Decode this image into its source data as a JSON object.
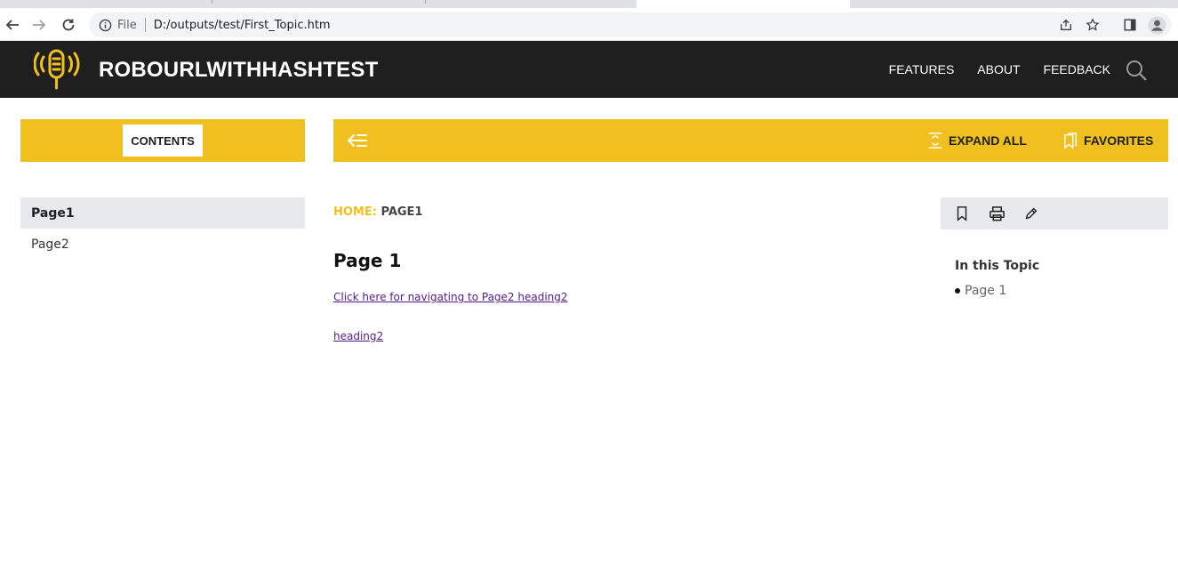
{
  "browser": {
    "file_label": "File",
    "url": "D:/outputs/test/First_Topic.htm"
  },
  "header": {
    "title": "ROBOURLWITHHASHTEST",
    "nav": [
      "FEATURES",
      "ABOUT",
      "FEEDBACK"
    ],
    "logo_color": "#f0c020",
    "background": "#1f1f1f"
  },
  "toolbar": {
    "contents_label": "CONTENTS",
    "expand_all_label": "EXPAND ALL",
    "favorites_label": "FAVORITES",
    "accent_color": "#f0c020"
  },
  "sidebar": {
    "items": [
      {
        "label": "Page1",
        "active": true
      },
      {
        "label": "Page2",
        "active": false
      }
    ]
  },
  "main": {
    "breadcrumb_home": "HOME:",
    "breadcrumb_current": "PAGE1",
    "title": "Page 1",
    "links": [
      "Click here for navigating to Page2 heading2",
      "heading2"
    ]
  },
  "right_panel": {
    "tools": [
      "bookmark-icon",
      "print-icon",
      "edit-icon"
    ],
    "in_topic_title": "In this Topic",
    "in_topic_items": [
      "Page 1"
    ]
  }
}
